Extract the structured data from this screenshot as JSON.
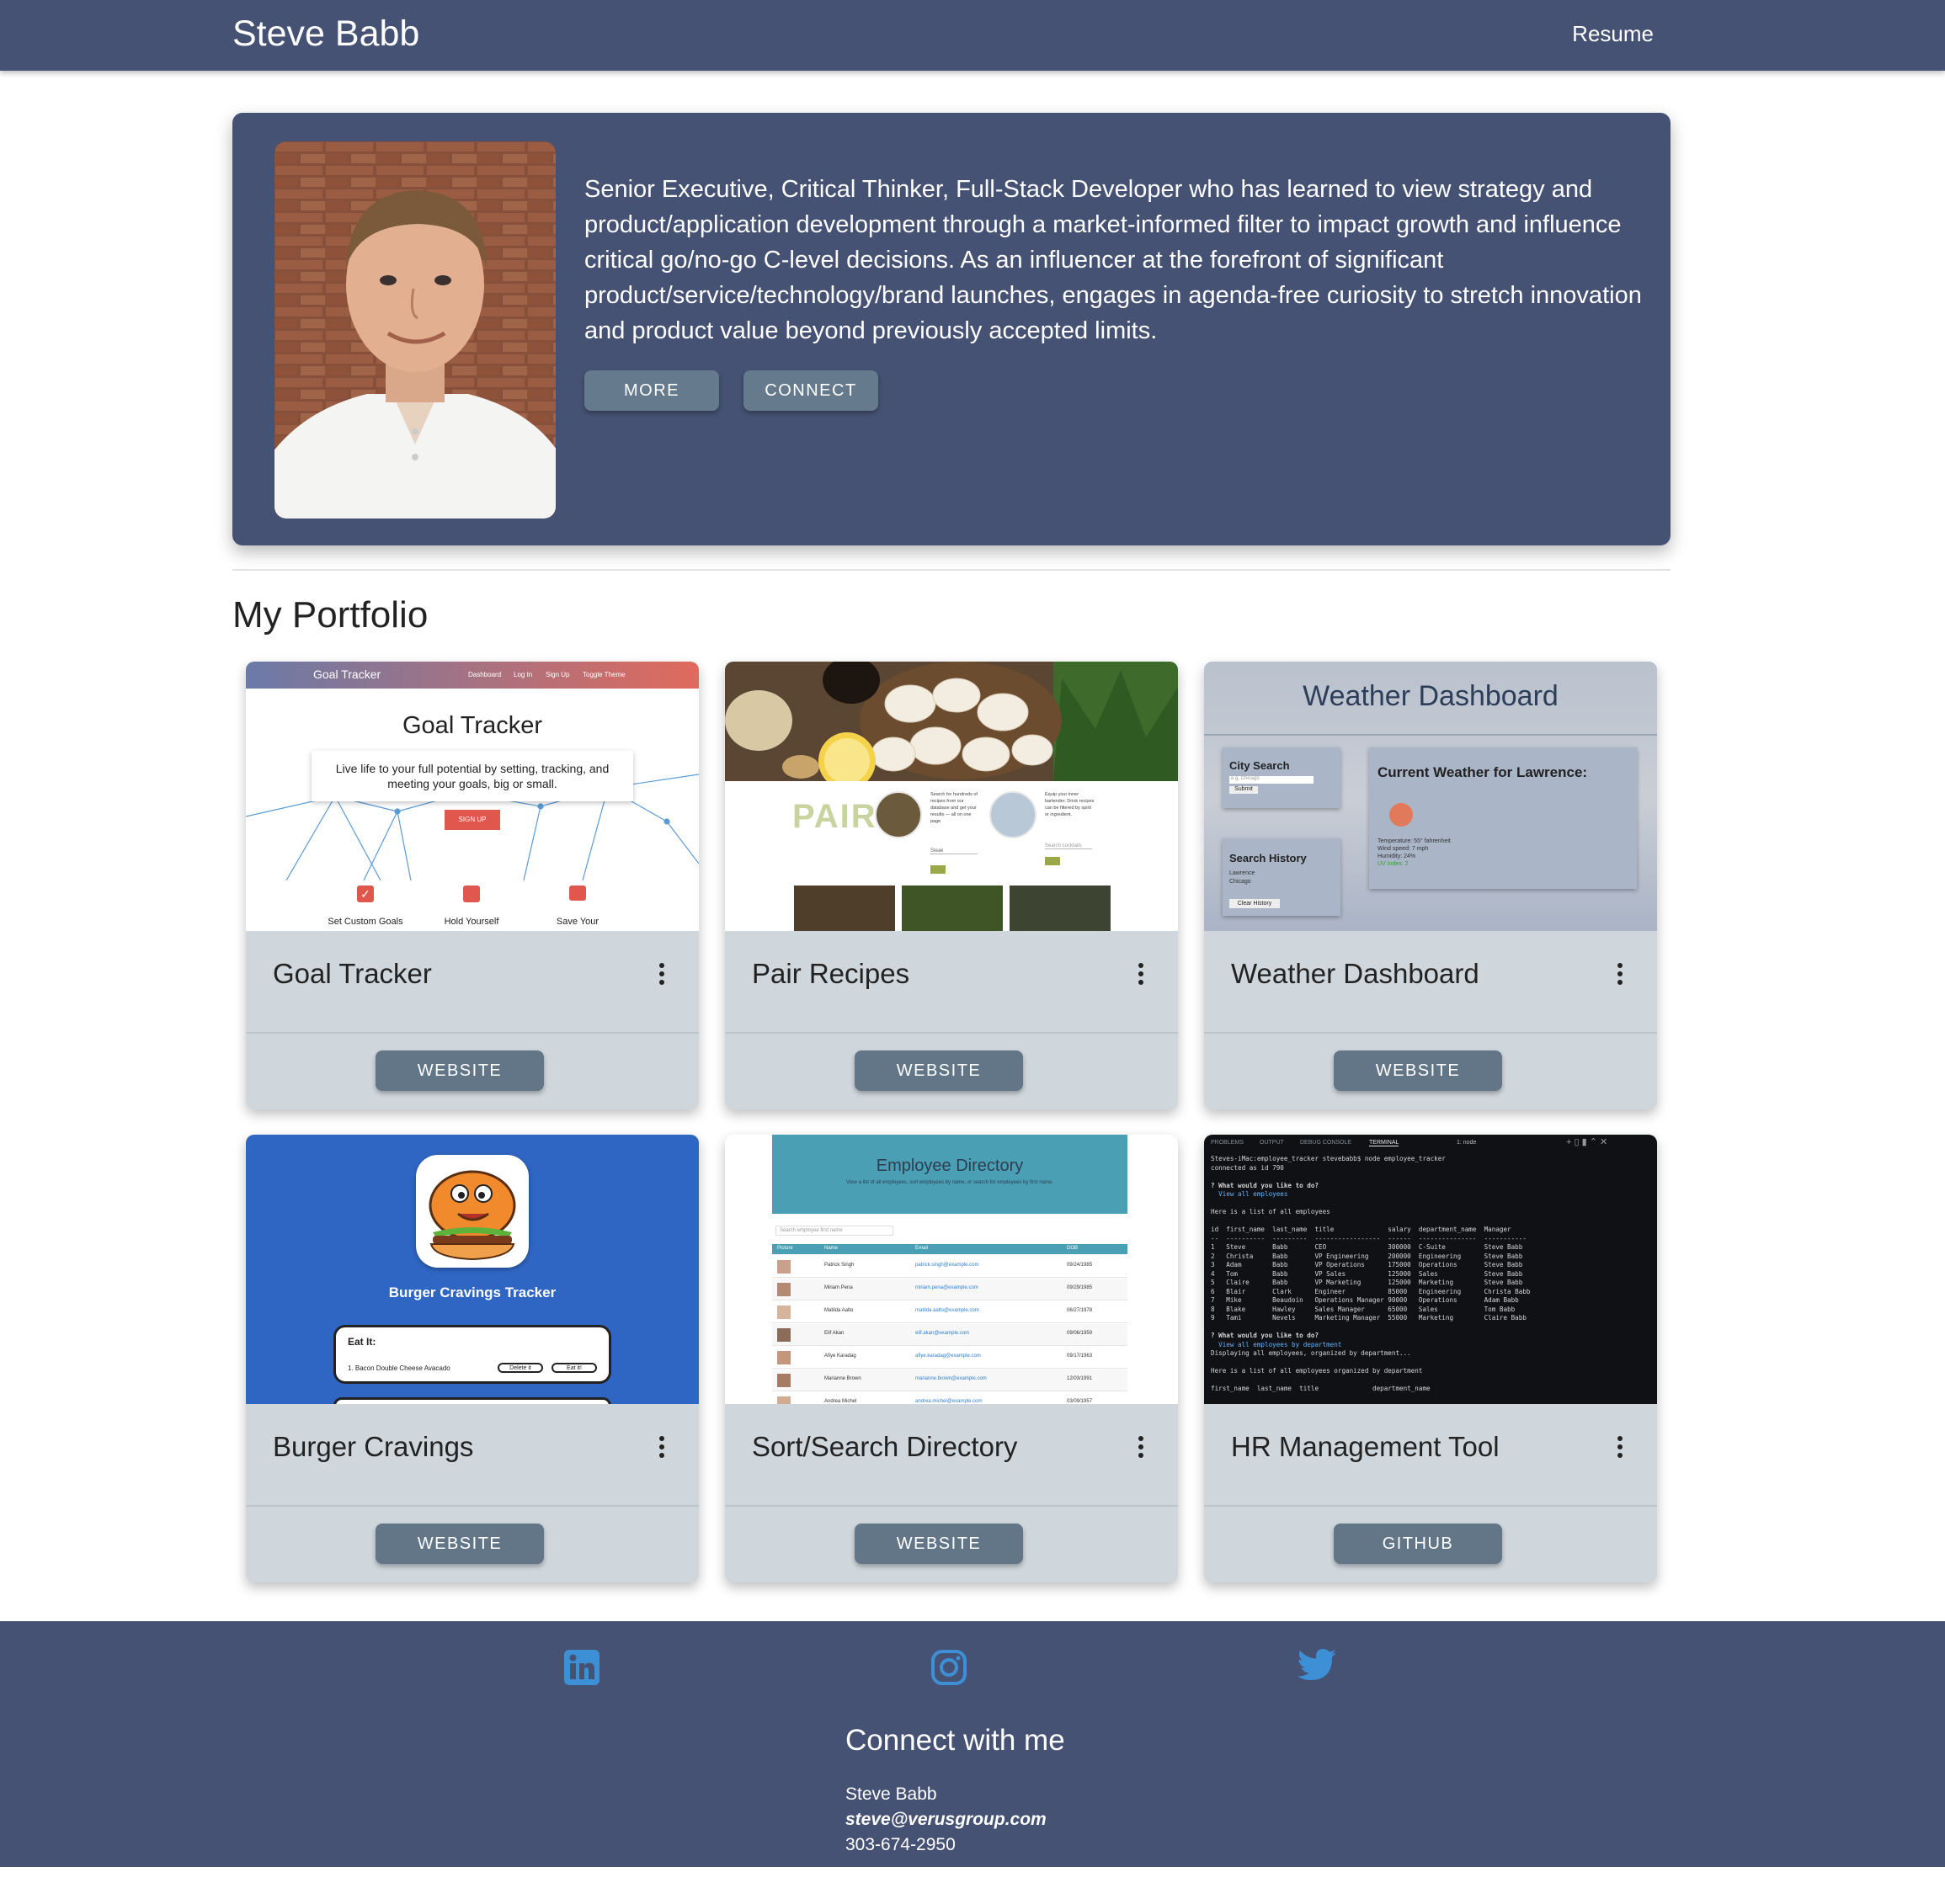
{
  "navbar": {
    "brand": "Steve Babb",
    "resume_link": "Resume"
  },
  "hero": {
    "bio": "Senior Executive, Critical Thinker, Full-Stack Developer who has learned to view strategy and product/application development through a market-informed filter to impact growth and influence critical go/no-go C-level decisions. As an influencer at the forefront of significant product/service/technology/brand launches, engages in agenda-free curiosity to stretch innovation and product value beyond previously accepted limits.",
    "more_label": "MORE",
    "connect_label": "CONNECT"
  },
  "portfolio": {
    "title": "My Portfolio",
    "cards": [
      {
        "title": "Goal Tracker",
        "button": "WEBSITE",
        "preview": {
          "nav_brand": "Goal Tracker",
          "nav_links": [
            "Dashboard",
            "Log In",
            "Sign Up",
            "Toggle Theme"
          ],
          "heading": "Goal Tracker",
          "tagline": "Live life to your full potential by setting, tracking, and meeting your goals, big or small.",
          "cta": "SIGN UP",
          "features": [
            "Set Custom Goals",
            "Hold Yourself",
            "Save Your"
          ]
        }
      },
      {
        "title": "Pair Recipes",
        "button": "WEBSITE",
        "preview": {
          "logo": "PAIR",
          "blurb_1": "Search for hundreds of recipes from our database and get your results — all on one page",
          "blurb_2": "Equip your inner bartender. Drink recipes can be filtered by spirit or ingredient.",
          "search_1": "Steak",
          "search_2": "Search cocktails"
        }
      },
      {
        "title": "Weather Dashboard",
        "button": "WEBSITE",
        "preview": {
          "heading": "Weather Dashboard",
          "city_search": "City Search",
          "placeholder": "e.g. Chicago",
          "submit": "Submit",
          "current": "Current Weather for Lawrence:",
          "temperature": "Temperature: 55° fahrenheit",
          "wind": "Wind speed: 7 mph",
          "humidity": "Humidity: 24%",
          "uv": "UV Index: 2",
          "history_title": "Search History",
          "history": [
            "Lawrence",
            "Chicago"
          ],
          "clear": "Clear History"
        }
      },
      {
        "title": "Burger Cravings",
        "button": "WEBSITE",
        "preview": {
          "heading": "Burger Cravings Tracker",
          "eat_title": "Eat It:",
          "item": "1. Bacon Double Cheese Avacado",
          "delete": "Delete it",
          "eat": "Eat it!"
        }
      },
      {
        "title": "Sort/Search Directory",
        "button": "WEBSITE",
        "preview": {
          "heading": "Employee Directory",
          "subheading": "View a list of all employees, sort employees by name, or search for employees by first name.",
          "search_placeholder": "Search employee first name",
          "columns": [
            "Picture",
            "Name",
            "Email",
            "DOB"
          ],
          "rows": [
            [
              "Patrick Singh",
              "patrick.singh@example.com",
              "09/24/1985"
            ],
            [
              "Miriam Pena",
              "miriam.pena@example.com",
              "09/29/1985"
            ],
            [
              "Matilda Aalto",
              "matilda.aalto@example.com",
              "06/27/1978"
            ],
            [
              "Elif Akan",
              "elif.akan@example.com",
              "09/06/1959"
            ],
            [
              "Afiye Karadag",
              "afiye.karadag@example.com",
              "09/17/1963"
            ],
            [
              "Marianne Brown",
              "marianne.brown@example.com",
              "12/03/1991"
            ],
            [
              "Andrea Michel",
              "andrea.michel@example.com",
              "03/09/1957"
            ]
          ]
        }
      },
      {
        "title": "HR Management Tool",
        "button": "GITHUB",
        "preview": {
          "tabs": [
            "PROBLEMS",
            "OUTPUT",
            "DEBUG CONSOLE",
            "TERMINAL"
          ],
          "shell": "1: node",
          "lines": [
            "Steves-iMac:employee_tracker stevebabb$ node employee_tracker",
            "connected as id 790",
            "",
            "? What would you like to do?",
            "  View all employees",
            "",
            "Here is a list of all employees",
            "",
            "id  first_name  last_name  title              salary  department_name  Manager",
            "--  ----------  ---------  -----------------  ------  ---------------  -----------",
            "1   Steve       Babb       CEO                300000  C-Suite          Steve Babb",
            "2   Christa     Babb       VP Engineering     200000  Engineering      Steve Babb",
            "3   Adam        Babb       VP Operations      175000  Operations       Steve Babb",
            "4   Tom         Babb       VP Sales           125000  Sales            Steve Babb",
            "5   Claire      Babb       VP Marketing       125000  Marketing        Steve Babb",
            "6   Blair       Clark      Engineer           85000   Engineering      Christa Babb",
            "7   Mike        Beaudoin   Operations Manager 90000   Operations       Adam Babb",
            "8   Blake       Hawley     Sales Manager      65000   Sales            Tom Babb",
            "9   Tami        Nevels     Marketing Manager  55000   Marketing        Claire Babb",
            "",
            "? What would you like to do?",
            "  View all employees by department",
            "Displaying all employees, organized by department...",
            "",
            "Here is a list of all employees organized by department",
            "",
            "first_name  last_name  title              department_name"
          ]
        }
      }
    ]
  },
  "footer": {
    "icons": [
      "linkedin-icon",
      "instagram-icon",
      "twitter-icon"
    ],
    "heading": "Connect with me",
    "name": "Steve Babb",
    "email": "steve@verusgroup.com",
    "phone": "303-674-2950"
  },
  "colors": {
    "nav": "#465274",
    "card": "#cfd7dd",
    "button": "#627688",
    "social": "#3d8fd6"
  }
}
